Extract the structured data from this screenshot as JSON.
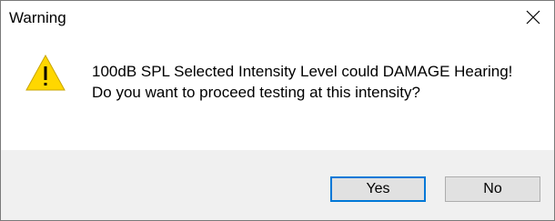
{
  "dialog": {
    "title": "Warning",
    "close_icon": "close-icon",
    "icon": "warning-icon",
    "message": "100dB SPL Selected Intensity Level could DAMAGE Hearing! Do you want to proceed testing at this intensity?",
    "buttons": {
      "yes_label": "Yes",
      "no_label": "No"
    },
    "colors": {
      "warning_fill": "#FFD700",
      "default_button_border": "#0078d7",
      "footer_background": "#f0f0f0"
    }
  }
}
